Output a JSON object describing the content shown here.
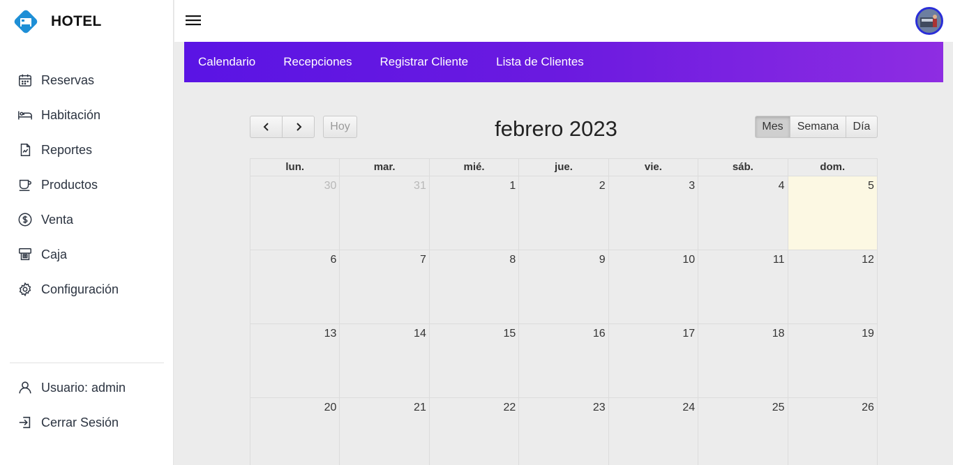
{
  "brand": {
    "name": "HOTEL"
  },
  "sidebar": {
    "items": [
      {
        "label": "Reservas",
        "icon": "calendar-icon"
      },
      {
        "label": "Habitación",
        "icon": "bed-icon"
      },
      {
        "label": "Reportes",
        "icon": "report-icon"
      },
      {
        "label": "Productos",
        "icon": "cup-icon"
      },
      {
        "label": "Venta",
        "icon": "dollar-icon"
      },
      {
        "label": "Caja",
        "icon": "cash-register-icon"
      },
      {
        "label": "Configuración",
        "icon": "gear-icon"
      }
    ],
    "bottom": [
      {
        "label": "Usuario: admin",
        "icon": "user-icon"
      },
      {
        "label": "Cerrar Sesión",
        "icon": "logout-icon"
      }
    ]
  },
  "tabs": [
    "Calendario",
    "Recepciones",
    "Registrar Cliente",
    "Lista de Clientes"
  ],
  "calendar": {
    "title": "febrero 2023",
    "today_label": "Hoy",
    "views": {
      "month": "Mes",
      "week": "Semana",
      "day": "Día"
    },
    "active_view": "Mes",
    "weekdays": [
      "lun.",
      "mar.",
      "mié.",
      "jue.",
      "vie.",
      "sáb.",
      "dom."
    ],
    "weeks": [
      [
        "30",
        "31",
        "1",
        "2",
        "3",
        "4",
        "5"
      ],
      [
        "6",
        "7",
        "8",
        "9",
        "10",
        "11",
        "12"
      ],
      [
        "13",
        "14",
        "15",
        "16",
        "17",
        "18",
        "19"
      ],
      [
        "20",
        "21",
        "22",
        "23",
        "24",
        "25",
        "26"
      ]
    ],
    "other_month_days": [
      "30",
      "31"
    ],
    "today": "5"
  },
  "colors": {
    "accent_start": "#5a14e4",
    "accent_end": "#8e2de2",
    "today_bg": "#fcf8e3",
    "logo": "#1e8fd6"
  }
}
